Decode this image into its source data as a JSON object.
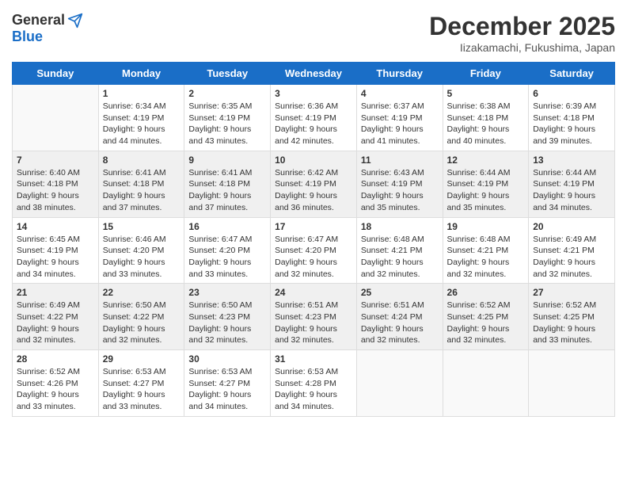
{
  "header": {
    "logo_general": "General",
    "logo_blue": "Blue",
    "month_title": "December 2025",
    "location": "Iizakamachi, Fukushima, Japan"
  },
  "days_of_week": [
    "Sunday",
    "Monday",
    "Tuesday",
    "Wednesday",
    "Thursday",
    "Friday",
    "Saturday"
  ],
  "weeks": [
    {
      "bg": "white",
      "days": [
        {
          "num": "",
          "info": ""
        },
        {
          "num": "1",
          "info": "Sunrise: 6:34 AM\nSunset: 4:19 PM\nDaylight: 9 hours\nand 44 minutes."
        },
        {
          "num": "2",
          "info": "Sunrise: 6:35 AM\nSunset: 4:19 PM\nDaylight: 9 hours\nand 43 minutes."
        },
        {
          "num": "3",
          "info": "Sunrise: 6:36 AM\nSunset: 4:19 PM\nDaylight: 9 hours\nand 42 minutes."
        },
        {
          "num": "4",
          "info": "Sunrise: 6:37 AM\nSunset: 4:19 PM\nDaylight: 9 hours\nand 41 minutes."
        },
        {
          "num": "5",
          "info": "Sunrise: 6:38 AM\nSunset: 4:18 PM\nDaylight: 9 hours\nand 40 minutes."
        },
        {
          "num": "6",
          "info": "Sunrise: 6:39 AM\nSunset: 4:18 PM\nDaylight: 9 hours\nand 39 minutes."
        }
      ]
    },
    {
      "bg": "light",
      "days": [
        {
          "num": "7",
          "info": "Sunrise: 6:40 AM\nSunset: 4:18 PM\nDaylight: 9 hours\nand 38 minutes."
        },
        {
          "num": "8",
          "info": "Sunrise: 6:41 AM\nSunset: 4:18 PM\nDaylight: 9 hours\nand 37 minutes."
        },
        {
          "num": "9",
          "info": "Sunrise: 6:41 AM\nSunset: 4:18 PM\nDaylight: 9 hours\nand 37 minutes."
        },
        {
          "num": "10",
          "info": "Sunrise: 6:42 AM\nSunset: 4:19 PM\nDaylight: 9 hours\nand 36 minutes."
        },
        {
          "num": "11",
          "info": "Sunrise: 6:43 AM\nSunset: 4:19 PM\nDaylight: 9 hours\nand 35 minutes."
        },
        {
          "num": "12",
          "info": "Sunrise: 6:44 AM\nSunset: 4:19 PM\nDaylight: 9 hours\nand 35 minutes."
        },
        {
          "num": "13",
          "info": "Sunrise: 6:44 AM\nSunset: 4:19 PM\nDaylight: 9 hours\nand 34 minutes."
        }
      ]
    },
    {
      "bg": "white",
      "days": [
        {
          "num": "14",
          "info": "Sunrise: 6:45 AM\nSunset: 4:19 PM\nDaylight: 9 hours\nand 34 minutes."
        },
        {
          "num": "15",
          "info": "Sunrise: 6:46 AM\nSunset: 4:20 PM\nDaylight: 9 hours\nand 33 minutes."
        },
        {
          "num": "16",
          "info": "Sunrise: 6:47 AM\nSunset: 4:20 PM\nDaylight: 9 hours\nand 33 minutes."
        },
        {
          "num": "17",
          "info": "Sunrise: 6:47 AM\nSunset: 4:20 PM\nDaylight: 9 hours\nand 32 minutes."
        },
        {
          "num": "18",
          "info": "Sunrise: 6:48 AM\nSunset: 4:21 PM\nDaylight: 9 hours\nand 32 minutes."
        },
        {
          "num": "19",
          "info": "Sunrise: 6:48 AM\nSunset: 4:21 PM\nDaylight: 9 hours\nand 32 minutes."
        },
        {
          "num": "20",
          "info": "Sunrise: 6:49 AM\nSunset: 4:21 PM\nDaylight: 9 hours\nand 32 minutes."
        }
      ]
    },
    {
      "bg": "light",
      "days": [
        {
          "num": "21",
          "info": "Sunrise: 6:49 AM\nSunset: 4:22 PM\nDaylight: 9 hours\nand 32 minutes."
        },
        {
          "num": "22",
          "info": "Sunrise: 6:50 AM\nSunset: 4:22 PM\nDaylight: 9 hours\nand 32 minutes."
        },
        {
          "num": "23",
          "info": "Sunrise: 6:50 AM\nSunset: 4:23 PM\nDaylight: 9 hours\nand 32 minutes."
        },
        {
          "num": "24",
          "info": "Sunrise: 6:51 AM\nSunset: 4:23 PM\nDaylight: 9 hours\nand 32 minutes."
        },
        {
          "num": "25",
          "info": "Sunrise: 6:51 AM\nSunset: 4:24 PM\nDaylight: 9 hours\nand 32 minutes."
        },
        {
          "num": "26",
          "info": "Sunrise: 6:52 AM\nSunset: 4:25 PM\nDaylight: 9 hours\nand 32 minutes."
        },
        {
          "num": "27",
          "info": "Sunrise: 6:52 AM\nSunset: 4:25 PM\nDaylight: 9 hours\nand 33 minutes."
        }
      ]
    },
    {
      "bg": "white",
      "days": [
        {
          "num": "28",
          "info": "Sunrise: 6:52 AM\nSunset: 4:26 PM\nDaylight: 9 hours\nand 33 minutes."
        },
        {
          "num": "29",
          "info": "Sunrise: 6:53 AM\nSunset: 4:27 PM\nDaylight: 9 hours\nand 33 minutes."
        },
        {
          "num": "30",
          "info": "Sunrise: 6:53 AM\nSunset: 4:27 PM\nDaylight: 9 hours\nand 34 minutes."
        },
        {
          "num": "31",
          "info": "Sunrise: 6:53 AM\nSunset: 4:28 PM\nDaylight: 9 hours\nand 34 minutes."
        },
        {
          "num": "",
          "info": ""
        },
        {
          "num": "",
          "info": ""
        },
        {
          "num": "",
          "info": ""
        }
      ]
    }
  ]
}
